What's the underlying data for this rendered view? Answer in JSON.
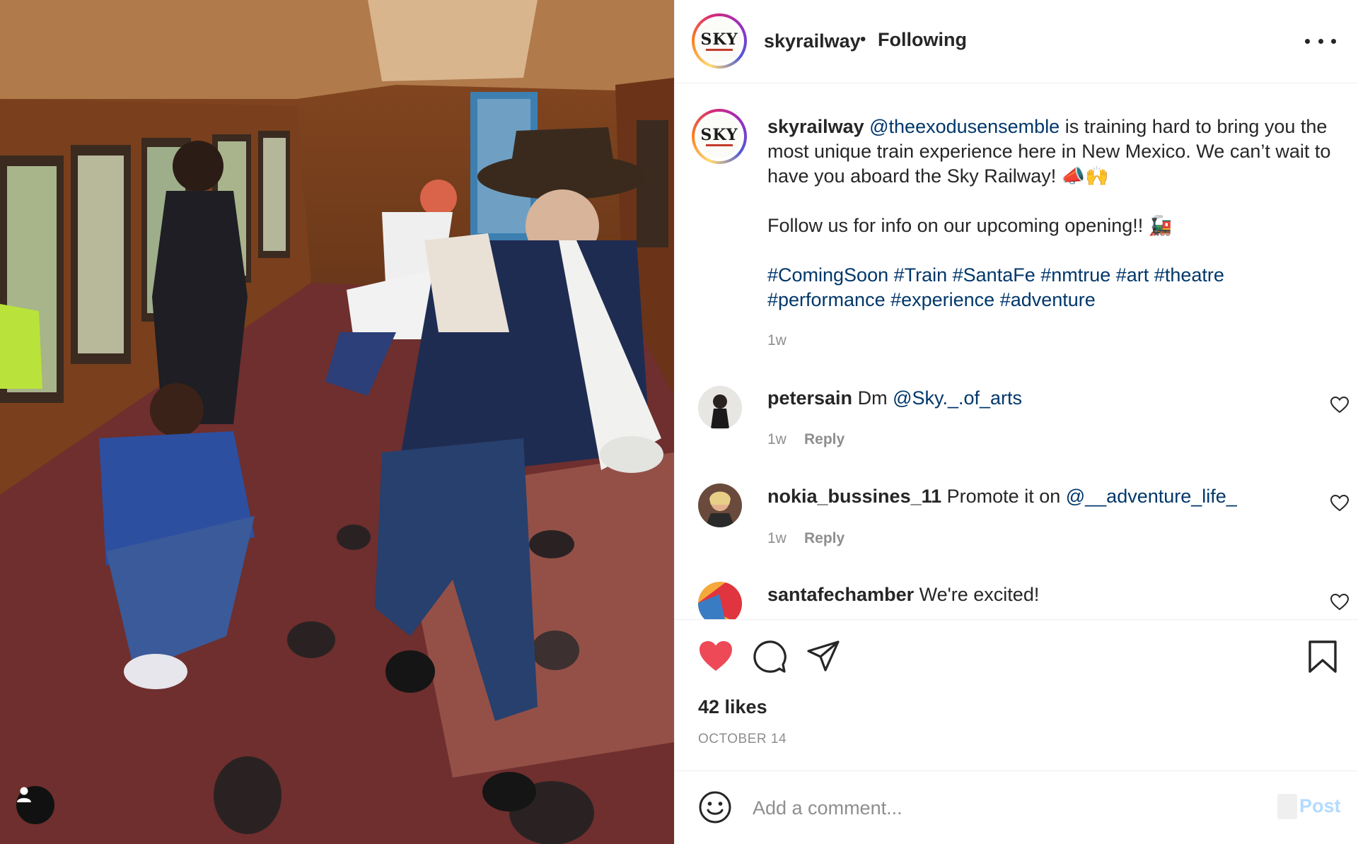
{
  "post": {
    "username": "skyrailway",
    "follow_status": "Following",
    "logo_text": "SKY"
  },
  "caption": {
    "username": "skyrailway",
    "mention": "@theexodusensemble",
    "text1": " is training hard to bring you the most unique train experience here in New Mexico. We can’t wait to have you aboard the Sky Railway! 📣🙌",
    "text2": "Follow us for info on our upcoming opening!! 🚂",
    "hashtags": "#ComingSoon #Train #SantaFe #nmtrue #art #theatre #performance #experience #adventure",
    "time": "1w"
  },
  "comments": [
    {
      "username": "petersain",
      "text": "Dm ",
      "mention": "@Sky._.of_arts",
      "time": "1w",
      "reply": "Reply"
    },
    {
      "username": "nokia_bussines_11",
      "text": "Promote it on ",
      "mention": "@__adventure_life_",
      "time": "1w",
      "reply": "Reply"
    },
    {
      "username": "santafechamber",
      "text": "We're excited!",
      "mention": "",
      "time": "",
      "reply": ""
    }
  ],
  "stats": {
    "likes": "42 likes",
    "date": "OCTOBER 14"
  },
  "add_comment": {
    "placeholder": "Add a comment...",
    "post_label": "Post"
  },
  "colors": {
    "like_red": "#ed4956",
    "link_blue": "#00376b",
    "post_disabled": "#b3dbff"
  }
}
